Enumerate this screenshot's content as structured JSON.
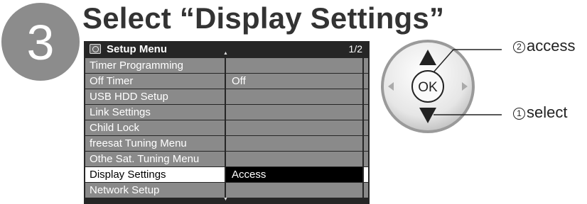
{
  "step": {
    "number": "3",
    "heading": "Select “Display Settings”"
  },
  "menu": {
    "title": "Setup Menu",
    "page": "1/2",
    "rows": [
      {
        "label": "Timer Programming",
        "value": ""
      },
      {
        "label": "Off Timer",
        "value": "Off"
      },
      {
        "label": "USB HDD Setup",
        "value": ""
      },
      {
        "label": "Link Settings",
        "value": ""
      },
      {
        "label": "Child Lock",
        "value": ""
      },
      {
        "label": "freesat Tuning Menu",
        "value": ""
      },
      {
        "label": "Othe Sat. Tuning Menu",
        "value": ""
      },
      {
        "label": "Display Settings",
        "value": "Access"
      },
      {
        "label": "Network Setup",
        "value": ""
      }
    ],
    "selected_index": 7
  },
  "remote": {
    "ok_label": "OK",
    "access": {
      "marker": "2",
      "label": "access"
    },
    "select": {
      "marker": "1",
      "label": "select"
    }
  },
  "colors": {
    "step_circle": "#8c8c8c",
    "menu_background": "#262626",
    "row_background": "#8a8a8a",
    "selected_label": "#ffffff",
    "selected_value": "#000000"
  },
  "icons": [
    "setup-menu-icon",
    "up-arrow-icon",
    "down-arrow-icon",
    "left-arrow-icon",
    "right-arrow-icon",
    "ok-button"
  ]
}
